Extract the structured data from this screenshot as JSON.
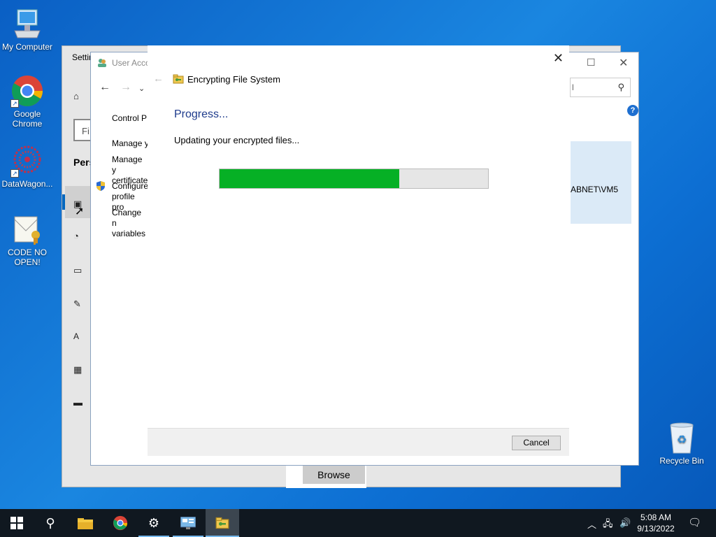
{
  "desktop": {
    "icons": [
      {
        "label": "My Computer",
        "icon": "computer-icon"
      },
      {
        "label": "Google Chrome",
        "icon": "chrome-icon"
      },
      {
        "label": "DataWagon...",
        "icon": "datawagon-icon"
      },
      {
        "label": "CODE NO OPEN!",
        "icon": "certificate-file-icon"
      },
      {
        "label": "Recycle Bin",
        "icon": "recycle-bin-icon"
      }
    ]
  },
  "settings_window": {
    "title": "Settin",
    "find_placeholder": "Fi",
    "section": "Pers",
    "browse_label": "Browse"
  },
  "user_accounts_window": {
    "title": "User Acco",
    "links": [
      "Control P",
      "Manage y",
      "Manage y certificate",
      "Configure profile pro",
      "Change n variables"
    ],
    "search_text": "l",
    "account_name": "ABNET\\VM5",
    "help_label": "?"
  },
  "efs_dialog": {
    "title": "Encrypting File System",
    "heading": "Progress...",
    "message": "Updating your encrypted files...",
    "progress_fraction": 0.67,
    "cancel_label": "Cancel"
  },
  "taskbar": {
    "items": [
      "start",
      "search",
      "file-explorer",
      "chrome",
      "settings",
      "control-panel",
      "efs"
    ],
    "time": "5:08 AM",
    "date": "9/13/2022"
  },
  "colors": {
    "progress_fill": "#06b025",
    "heading_blue": "#1e3b8c",
    "accent": "#0067c0"
  }
}
